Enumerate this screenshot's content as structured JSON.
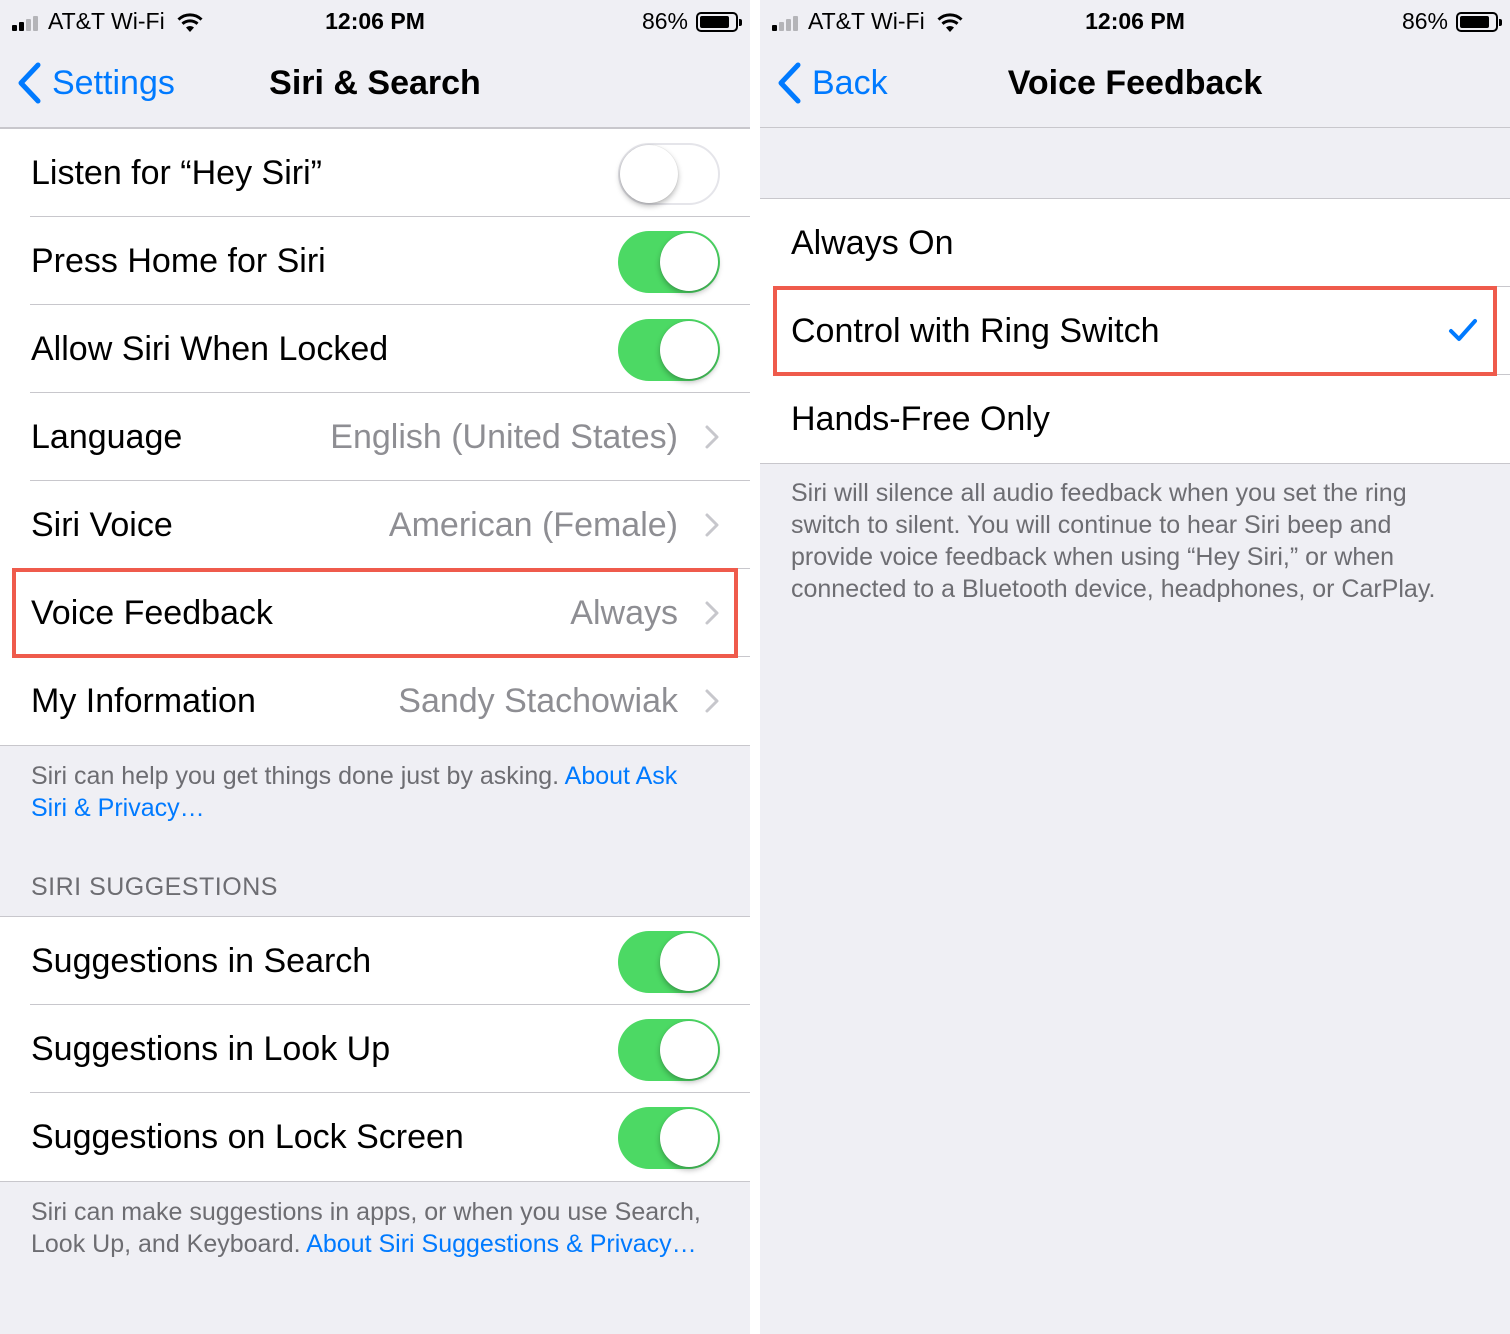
{
  "colors": {
    "accent": "#007aff",
    "toggle_on": "#4cd964",
    "highlight": "#ef5b4c",
    "background": "#efeff4",
    "secondary_text": "#8e8e93"
  },
  "left": {
    "status": {
      "carrier": "AT&T Wi-Fi",
      "time": "12:06 PM",
      "battery": "86%",
      "battery_level": 0.86
    },
    "nav": {
      "back_label": "Settings",
      "title": "Siri & Search"
    },
    "rows": [
      {
        "label": "Listen for “Hey Siri”",
        "toggle": false
      },
      {
        "label": "Press Home for Siri",
        "toggle": true
      },
      {
        "label": "Allow Siri When Locked",
        "toggle": true
      },
      {
        "label": "Language",
        "value": "English (United States)"
      },
      {
        "label": "Siri Voice",
        "value": "American (Female)"
      },
      {
        "label": "Voice Feedback",
        "value": "Always",
        "highlighted": true
      },
      {
        "label": "My Information",
        "value": "Sandy Stachowiak"
      }
    ],
    "footer1": {
      "text": "Siri can help you get things done just by asking. ",
      "link": "About Ask Siri & Privacy…"
    },
    "section_header": "SIRI SUGGESTIONS",
    "suggestions": [
      {
        "label": "Suggestions in Search",
        "toggle": true
      },
      {
        "label": "Suggestions in Look Up",
        "toggle": true
      },
      {
        "label": "Suggestions on Lock Screen",
        "toggle": true
      }
    ],
    "footer2": {
      "text": "Siri can make suggestions in apps, or when you use Search, Look Up, and Keyboard. ",
      "link": "About Siri Suggestions & Privacy…"
    }
  },
  "right": {
    "status": {
      "carrier": "AT&T Wi-Fi",
      "time": "12:06 PM",
      "battery": "86%",
      "battery_level": 0.86
    },
    "nav": {
      "back_label": "Back",
      "title": "Voice Feedback"
    },
    "options": [
      {
        "label": "Always On",
        "selected": false
      },
      {
        "label": "Control with Ring Switch",
        "selected": true,
        "highlighted": true
      },
      {
        "label": "Hands-Free Only",
        "selected": false
      }
    ],
    "footer": "Siri will silence all audio feedback when you set the ring switch to silent. You will continue to hear Siri beep and provide voice feedback when using “Hey Siri,” or when connected to a Bluetooth device, headphones, or CarPlay."
  }
}
